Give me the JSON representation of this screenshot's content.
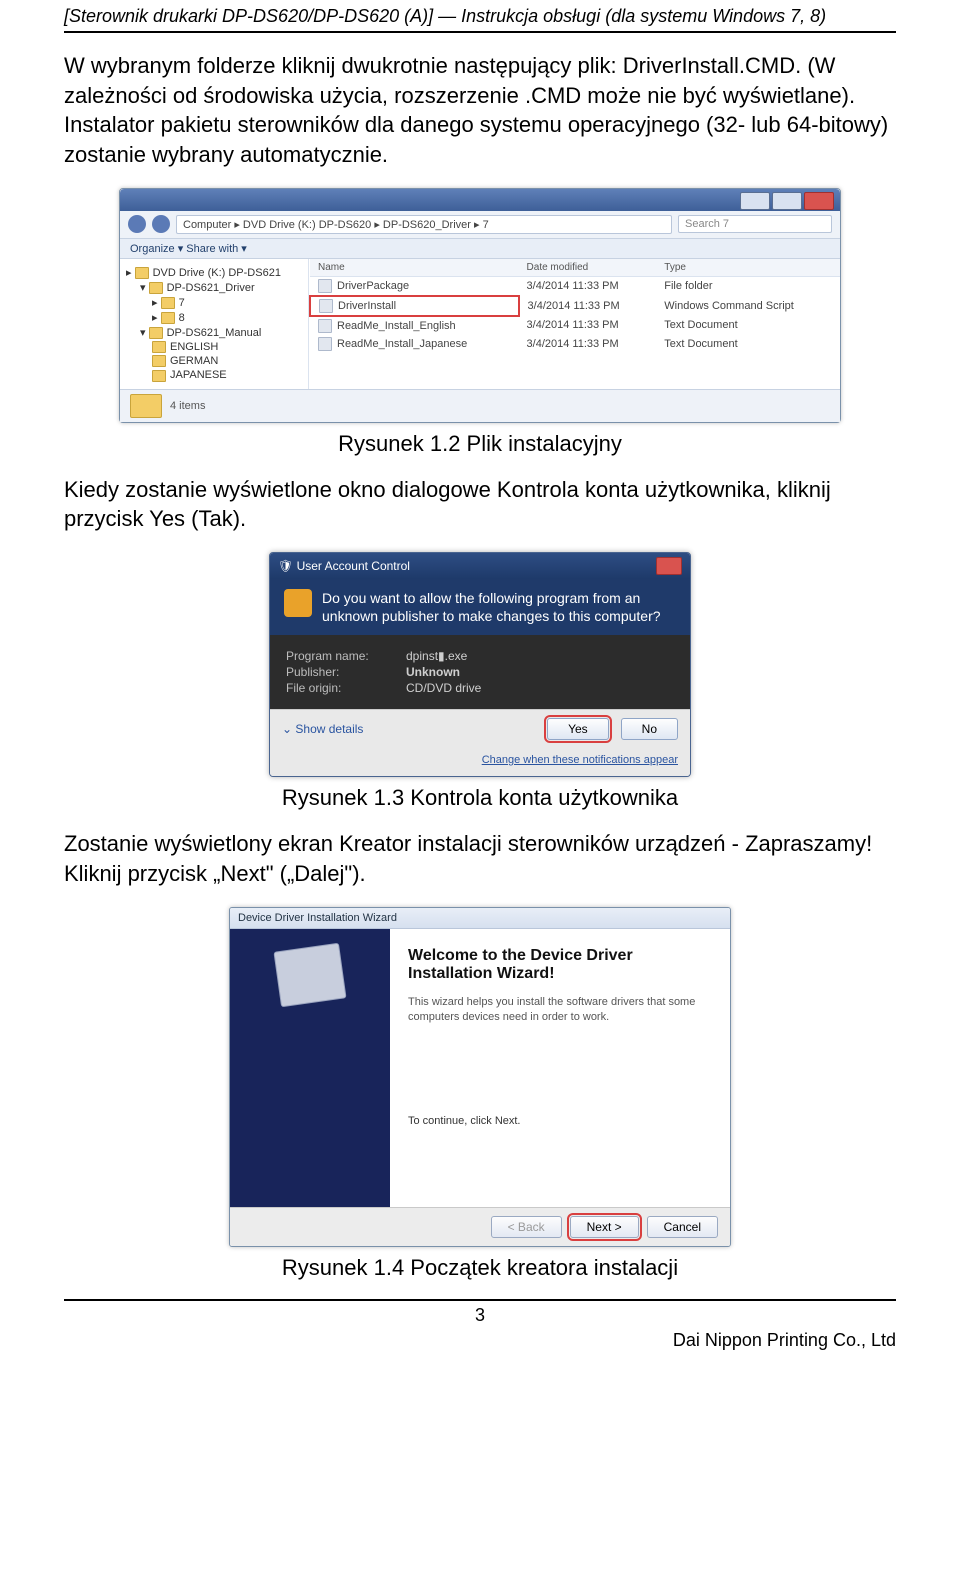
{
  "header": "[Sterownik drukarki DP-DS620/DP-DS620 (A)] — Instrukcja obsługi (dla systemu Windows 7, 8)",
  "para1": "W wybranym folderze kliknij dwukrotnie następujący plik: DriverInstall.CMD. (W zależności od środowiska użycia, rozszerzenie .CMD może nie być wyświetlane).\nInstalator pakietu sterowników dla danego systemu operacyjnego (32- lub 64-bitowy) zostanie wybrany automatycznie.",
  "explorer": {
    "path": "Computer ▸ DVD Drive (K:) DP-DS620 ▸ DP-DS620_Driver ▸ 7",
    "search_placeholder": "Search 7",
    "toolbar": "Organize ▾    Share with ▾",
    "tree": [
      {
        "label": "DVD Drive (K:) DP-DS621",
        "indent": 0
      },
      {
        "label": "DP-DS621_Driver",
        "indent": 1
      },
      {
        "label": "7",
        "indent": 2
      },
      {
        "label": "8",
        "indent": 2
      },
      {
        "label": "DP-DS621_Manual",
        "indent": 1
      },
      {
        "label": "ENGLISH",
        "indent": 2
      },
      {
        "label": "GERMAN",
        "indent": 2
      },
      {
        "label": "JAPANESE",
        "indent": 2
      }
    ],
    "columns": [
      "Name",
      "Date modified",
      "Type"
    ],
    "rows": [
      {
        "name": "DriverPackage",
        "date": "3/4/2014 11:33 PM",
        "type": "File folder",
        "hl": false
      },
      {
        "name": "DriverInstall",
        "date": "3/4/2014 11:33 PM",
        "type": "Windows Command Script",
        "hl": true
      },
      {
        "name": "ReadMe_Install_English",
        "date": "3/4/2014 11:33 PM",
        "type": "Text Document",
        "hl": false
      },
      {
        "name": "ReadMe_Install_Japanese",
        "date": "3/4/2014 11:33 PM",
        "type": "Text Document",
        "hl": false
      }
    ],
    "status": "4 items"
  },
  "caption1": "Rysunek 1.2 Plik instalacyjny",
  "para2": "Kiedy zostanie wyświetlone okno dialogowe Kontrola konta użytkownika, kliknij przycisk Yes (Tak).",
  "uac": {
    "title": "User Account Control",
    "question": "Do you want to allow the following program from an unknown publisher to make changes to this computer?",
    "program_k": "Program name:",
    "program_v": "dpinst▮.exe",
    "publisher_k": "Publisher:",
    "publisher_v": "Unknown",
    "origin_k": "File origin:",
    "origin_v": "CD/DVD drive",
    "show_details": "Show details",
    "yes": "Yes",
    "no": "No",
    "link": "Change when these notifications appear"
  },
  "caption2": "Rysunek 1.3 Kontrola konta użytkownika",
  "para3": "Zostanie wyświetlony ekran Kreator instalacji sterowników urządzeń - Zapraszamy! Kliknij przycisk „Next\" („Dalej\").",
  "wizard": {
    "bar": "Device Driver Installation Wizard",
    "title": "Welcome to the Device Driver Installation Wizard!",
    "sub": "This wizard helps you install the software drivers that some computers devices need in order to work.",
    "continue": "To continue, click Next.",
    "back": "< Back",
    "next": "Next >",
    "cancel": "Cancel"
  },
  "caption3": "Rysunek 1.4 Początek kreatora instalacji",
  "footer": {
    "page": "3",
    "company": "Dai Nippon Printing Co., Ltd"
  }
}
